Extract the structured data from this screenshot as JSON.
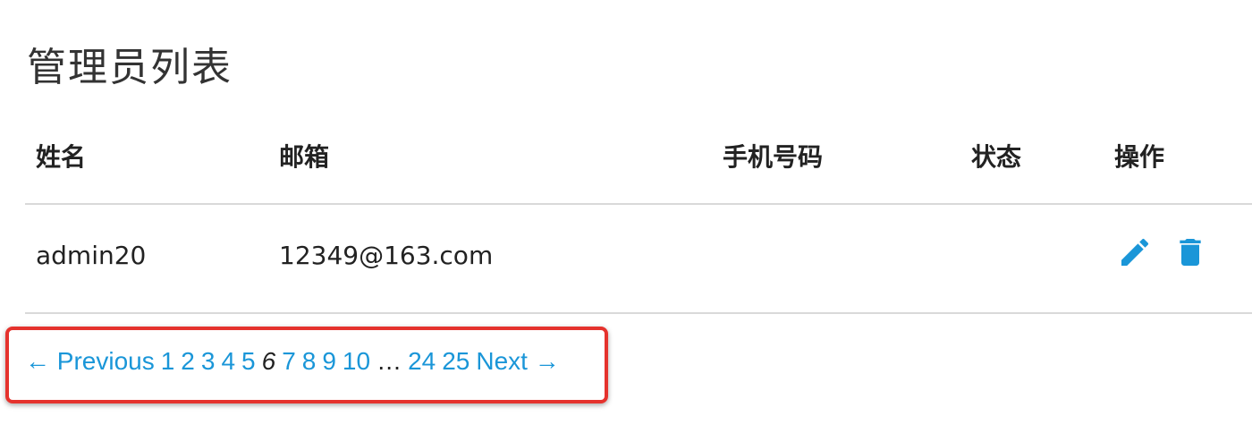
{
  "page": {
    "title": "管理员列表"
  },
  "table": {
    "headers": {
      "name": "姓名",
      "email": "邮箱",
      "phone": "手机号码",
      "status": "状态",
      "actions": "操作"
    },
    "rows": [
      {
        "name": "admin20",
        "email": "12349@163.com",
        "phone": "",
        "status": ""
      }
    ]
  },
  "pagination": {
    "previous": "← Previous",
    "pages": [
      "1",
      "2",
      "3",
      "4",
      "5",
      "6",
      "7",
      "8",
      "9",
      "10",
      "…",
      "24",
      "25"
    ],
    "current": "6",
    "next": "Next →"
  },
  "colors": {
    "accent": "#1a96d8",
    "highlight": "#e5322d",
    "divider": "#d9d9d9"
  },
  "icons": {
    "edit": "pencil-icon",
    "delete": "trash-icon"
  }
}
